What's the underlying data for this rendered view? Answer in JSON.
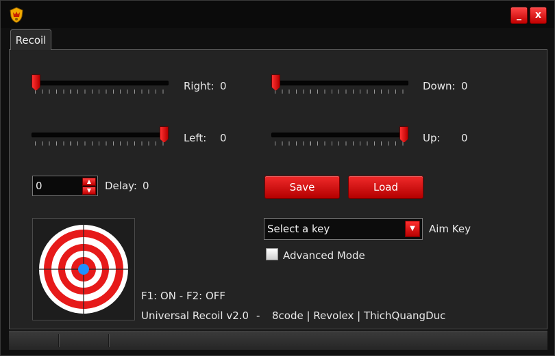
{
  "window": {
    "minimize_label": "_",
    "close_label": "x"
  },
  "tabs": [
    {
      "label": "Recoil"
    }
  ],
  "sliders": {
    "right": {
      "label": "Right:",
      "value": "0",
      "position": 0.0
    },
    "down": {
      "label": "Down:",
      "value": "0",
      "position": 0.0
    },
    "left": {
      "label": "Left:",
      "value": "0",
      "position": 1.0
    },
    "up": {
      "label": "Up:",
      "value": "0",
      "position": 1.0
    }
  },
  "delay": {
    "value": "0",
    "label": "Delay:",
    "display_value": "0"
  },
  "buttons": {
    "save": "Save",
    "load": "Load"
  },
  "aim_key": {
    "selected": "Select a key",
    "label": "Aim Key"
  },
  "advanced_mode": {
    "label": "Advanced Mode",
    "checked": false
  },
  "hotkeys": "F1: ON - F2: OFF",
  "footer": {
    "version": "Universal Recoil v2.0",
    "separator": "-",
    "credits": "8code | Revolex | ThichQuangDuc"
  },
  "colors": {
    "accent": "#d40000",
    "panel": "#232323",
    "target_blue": "#1e90ff"
  },
  "icons": {
    "app": "shield-crest-icon",
    "dropdown": "chevron-down-icon"
  }
}
